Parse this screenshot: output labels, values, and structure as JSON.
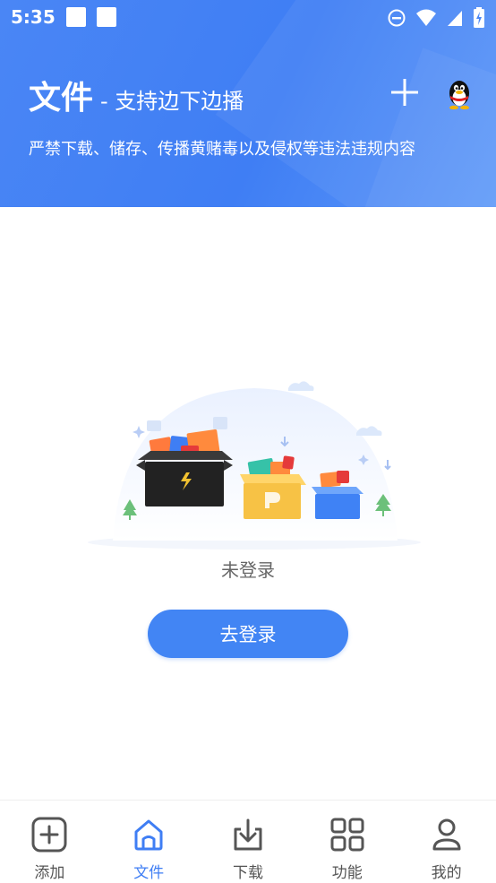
{
  "statusbar": {
    "time": "5:35"
  },
  "header": {
    "title": "文件",
    "subtitle": "- 支持边下边播",
    "notice": "严禁下载、储存、传播黄赌毒以及侵权等违法违规内容",
    "add_icon": "plus-icon",
    "qq_icon": "qq-penguin-icon"
  },
  "main": {
    "login_status": "未登录",
    "login_button": "去登录"
  },
  "tabbar": {
    "items": [
      {
        "label": "添加",
        "icon": "add-square-icon",
        "active": false
      },
      {
        "label": "文件",
        "icon": "home-icon",
        "active": true
      },
      {
        "label": "下载",
        "icon": "download-icon",
        "active": false
      },
      {
        "label": "功能",
        "icon": "grid-icon",
        "active": false
      },
      {
        "label": "我的",
        "icon": "profile-icon",
        "active": false
      }
    ]
  },
  "colors": {
    "accent": "#3f7ef4",
    "button": "#4285f4",
    "tab_inactive": "#555555"
  }
}
